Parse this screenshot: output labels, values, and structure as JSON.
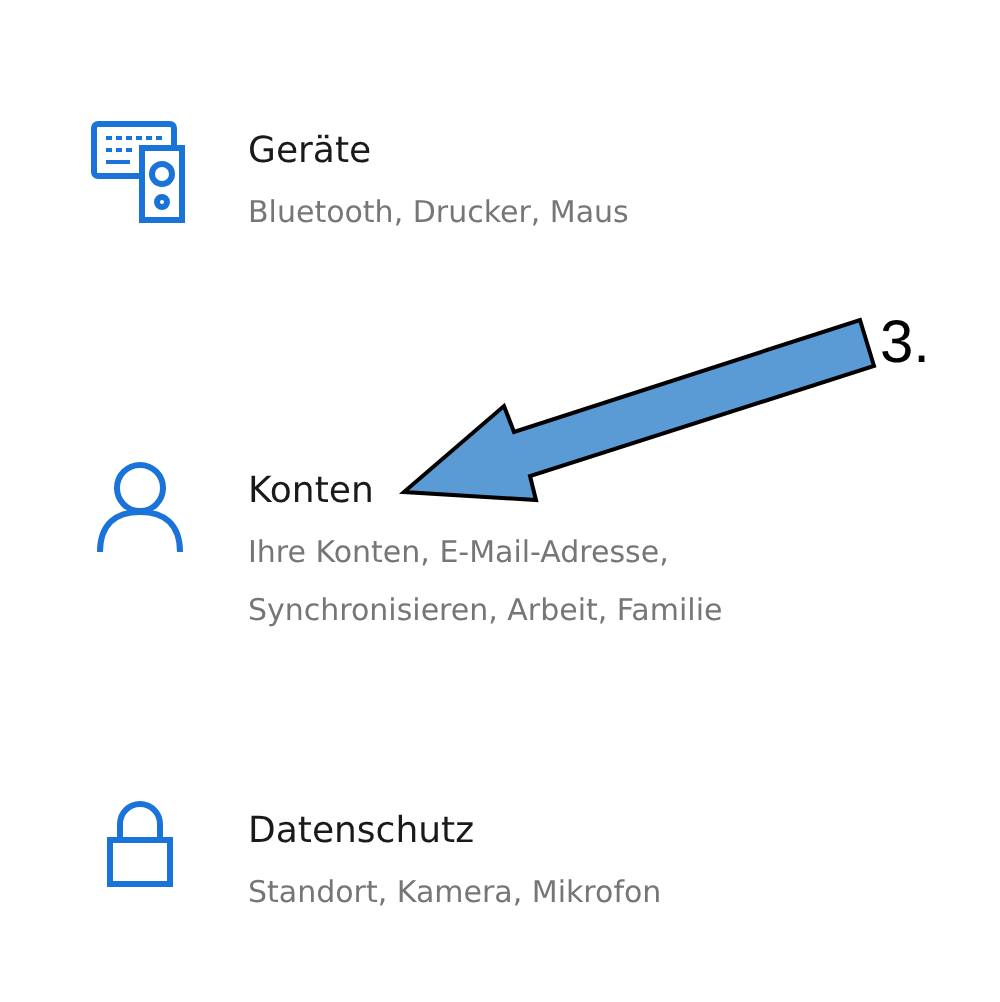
{
  "settings_items": [
    {
      "kind": "devices",
      "title": "Geräte",
      "subtitle_lines": [
        "Bluetooth, Drucker, Maus"
      ]
    },
    {
      "kind": "account",
      "title": "Konten",
      "subtitle_lines": [
        "Ihre Konten, E-Mail-Adresse,",
        "Synchronisieren, Arbeit, Familie"
      ]
    },
    {
      "kind": "privacy",
      "title": "Datenschutz",
      "subtitle_lines": [
        "Standort, Kamera, Mikrofon"
      ]
    }
  ],
  "annotation": {
    "label": "3."
  }
}
